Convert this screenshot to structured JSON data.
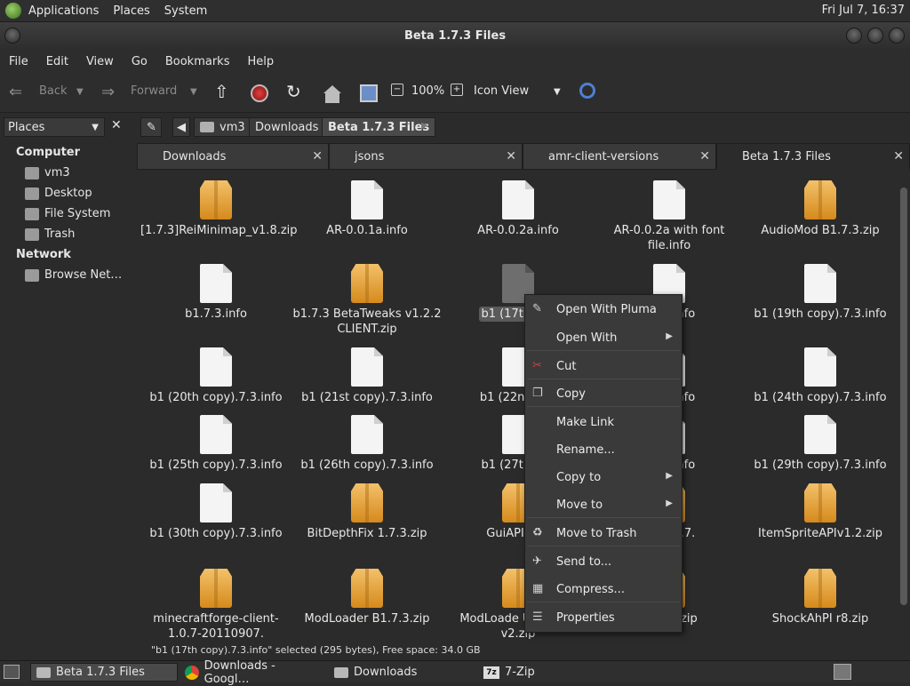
{
  "top_panel": {
    "menus": [
      "Applications",
      "Places",
      "System"
    ],
    "clock": "Fri Jul 7, 16:37"
  },
  "window": {
    "title": "Beta 1.7.3 Files"
  },
  "menubar": [
    "File",
    "Edit",
    "View",
    "Go",
    "Bookmarks",
    "Help"
  ],
  "toolbar": {
    "back": "Back",
    "forward": "Forward",
    "zoom": "100%",
    "view_mode": "Icon View"
  },
  "sidebar": {
    "selector_label": "Places",
    "sections": [
      {
        "title": "Computer",
        "items": [
          "vm3",
          "Desktop",
          "File System",
          "Trash"
        ]
      },
      {
        "title": "Network",
        "items": [
          "Browse Net…"
        ]
      }
    ]
  },
  "breadcrumb": [
    "vm3",
    "Downloads",
    "Beta 1.7.3 Files"
  ],
  "tabs": [
    "Downloads",
    "jsons",
    "amr-client-versions",
    "Beta 1.7.3 Files"
  ],
  "files": [
    {
      "name": "[1.7.3]ReiMinimap_v1.8.zip",
      "type": "zip"
    },
    {
      "name": "AR-0.0.1a.info",
      "type": "doc"
    },
    {
      "name": "AR-0.0.2a.info",
      "type": "doc"
    },
    {
      "name": "AR-0.0.2a with font file.info",
      "type": "doc"
    },
    {
      "name": "AudioMod B1.7.3.zip",
      "type": "zip"
    },
    {
      "name": "b1.7.3.info",
      "type": "doc"
    },
    {
      "name": "b1.7.3 BetaTweaks v1.2.2 CLIENT.zip",
      "type": "zip"
    },
    {
      "name": "b1 (17th cop",
      "type": "doc-sel"
    },
    {
      "name": ").7.3.info",
      "type": "doc"
    },
    {
      "name": "b1 (19th copy).7.3.info",
      "type": "doc"
    },
    {
      "name": "b1 (20th copy).7.3.info",
      "type": "doc"
    },
    {
      "name": "b1 (21st copy).7.3.info",
      "type": "doc"
    },
    {
      "name": "b1 (22nd cop",
      "type": "doc"
    },
    {
      "name": ").7.3.info",
      "type": "doc"
    },
    {
      "name": "b1 (24th copy).7.3.info",
      "type": "doc"
    },
    {
      "name": "b1 (25th copy).7.3.info",
      "type": "doc"
    },
    {
      "name": "b1 (26th copy).7.3.info",
      "type": "doc"
    },
    {
      "name": "b1 (27th cop",
      "type": "doc"
    },
    {
      "name": ").7.3.info",
      "type": "doc"
    },
    {
      "name": "b1 (29th copy).7.3.info",
      "type": "doc"
    },
    {
      "name": "b1 (30th copy).7.3.info",
      "type": "doc"
    },
    {
      "name": "BitDepthFix 1.7.3.zip",
      "type": "zip"
    },
    {
      "name": "GuiAPI0.10",
      "type": "zip"
    },
    {
      "name": ".31-B1.7.",
      "type": "zip"
    },
    {
      "name": "ItemSpriteAPIv1.2.zip",
      "type": "zip"
    },
    {
      "name": "minecraftforge-client-1.0.7-20110907.",
      "type": "zip"
    },
    {
      "name": "ModLoader B1.7.3.zip",
      "type": "zip"
    },
    {
      "name": "ModLoade Unofficial v2.zip",
      "type": "zip"
    },
    {
      "name": "3 v1.7.zip",
      "type": "zip"
    },
    {
      "name": "ShockAhPI r8.zip",
      "type": "zip"
    }
  ],
  "context_menu": {
    "items": [
      {
        "label": "Open With Pluma",
        "icon": "pluma-icon"
      },
      {
        "label": "Open With",
        "submenu": true
      },
      {
        "label": "Cut",
        "icon": "scissors-icon"
      },
      {
        "label": "Copy",
        "icon": "copy-icon"
      },
      {
        "label": "Make Link"
      },
      {
        "label": "Rename..."
      },
      {
        "label": "Copy to",
        "submenu": true
      },
      {
        "label": "Move to",
        "submenu": true
      },
      {
        "label": "Move to Trash",
        "icon": "trash-icon"
      },
      {
        "label": "Send to...",
        "icon": "send-icon"
      },
      {
        "label": "Compress...",
        "icon": "archive-icon"
      },
      {
        "label": "Properties",
        "icon": "properties-icon"
      }
    ]
  },
  "status": "\"b1 (17th copy).7.3.info\" selected (295 bytes), Free space: 34.0 GB",
  "taskbar": [
    "Beta 1.7.3 Files",
    "Downloads - Googl…",
    "Downloads",
    "7-Zip"
  ]
}
